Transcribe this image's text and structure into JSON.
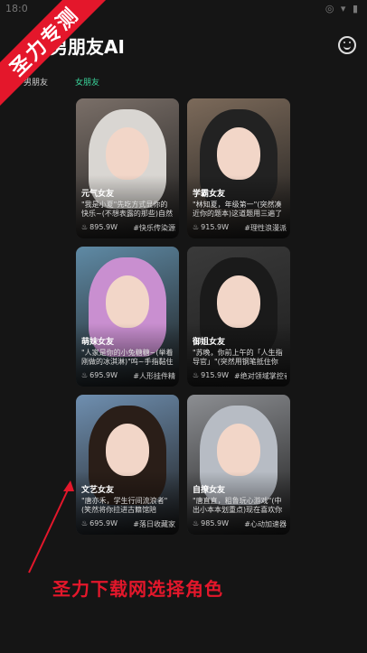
{
  "status_bar": {
    "time": "18:0",
    "icons": "◎ ▾ ▮"
  },
  "watermark": {
    "banner": "圣力专测",
    "caption": "圣力下载网选择角色"
  },
  "header": {
    "title": "男朋友AI"
  },
  "tabs": [
    {
      "label": "男朋友"
    },
    {
      "label": "女朋友"
    }
  ],
  "cards": [
    {
      "title": "元气女友",
      "desc": "\"我是小夏\"先吃方式显你的快乐~(不想表露的那些)自然",
      "count": "895.9W",
      "tag": "#快乐传染源",
      "bg": "#7a6f68",
      "hair": "#d9d6d2"
    },
    {
      "title": "学霸女友",
      "desc": "\"林知夏，年级第一\"(突然凑近你的题本)这道题用三遍了",
      "count": "915.9W",
      "tag": "#理性浪漫派",
      "bg": "#7c6a5a",
      "hair": "#222222"
    },
    {
      "title": "萌妹女友",
      "desc": "\"人家是你的小兔糖糖~(举着刚做的冰淇淋)\"呜~手指黏住",
      "count": "695.9W",
      "tag": "#人形挂件精",
      "bg": "#5f8aa5",
      "hair": "#c98fd0"
    },
    {
      "title": "御姐女友",
      "desc": "\"苏晚，你前上午的「人生指导官」\"(突然用钢笔抵住你",
      "count": "915.9W",
      "tag": "#绝对领域掌控者",
      "bg": "#3a3a3a",
      "hair": "#1a1a1a"
    },
    {
      "title": "文艺女友",
      "desc": "\"唐亦禾，学生行间流浪者\"(笑然将你拉进古籍馆陪",
      "count": "695.9W",
      "tag": "#落日收藏家",
      "bg": "#6f8fb0",
      "hair": "#2a1e18"
    },
    {
      "title": "自撩女友",
      "desc": "\"唐直直，粗鲁玩心游戏\"(中出小本本划重点)现在喜欢你",
      "count": "985.9W",
      "tag": "#心动加速器",
      "bg": "#8c8e92",
      "hair": "#b7bcc4"
    }
  ]
}
